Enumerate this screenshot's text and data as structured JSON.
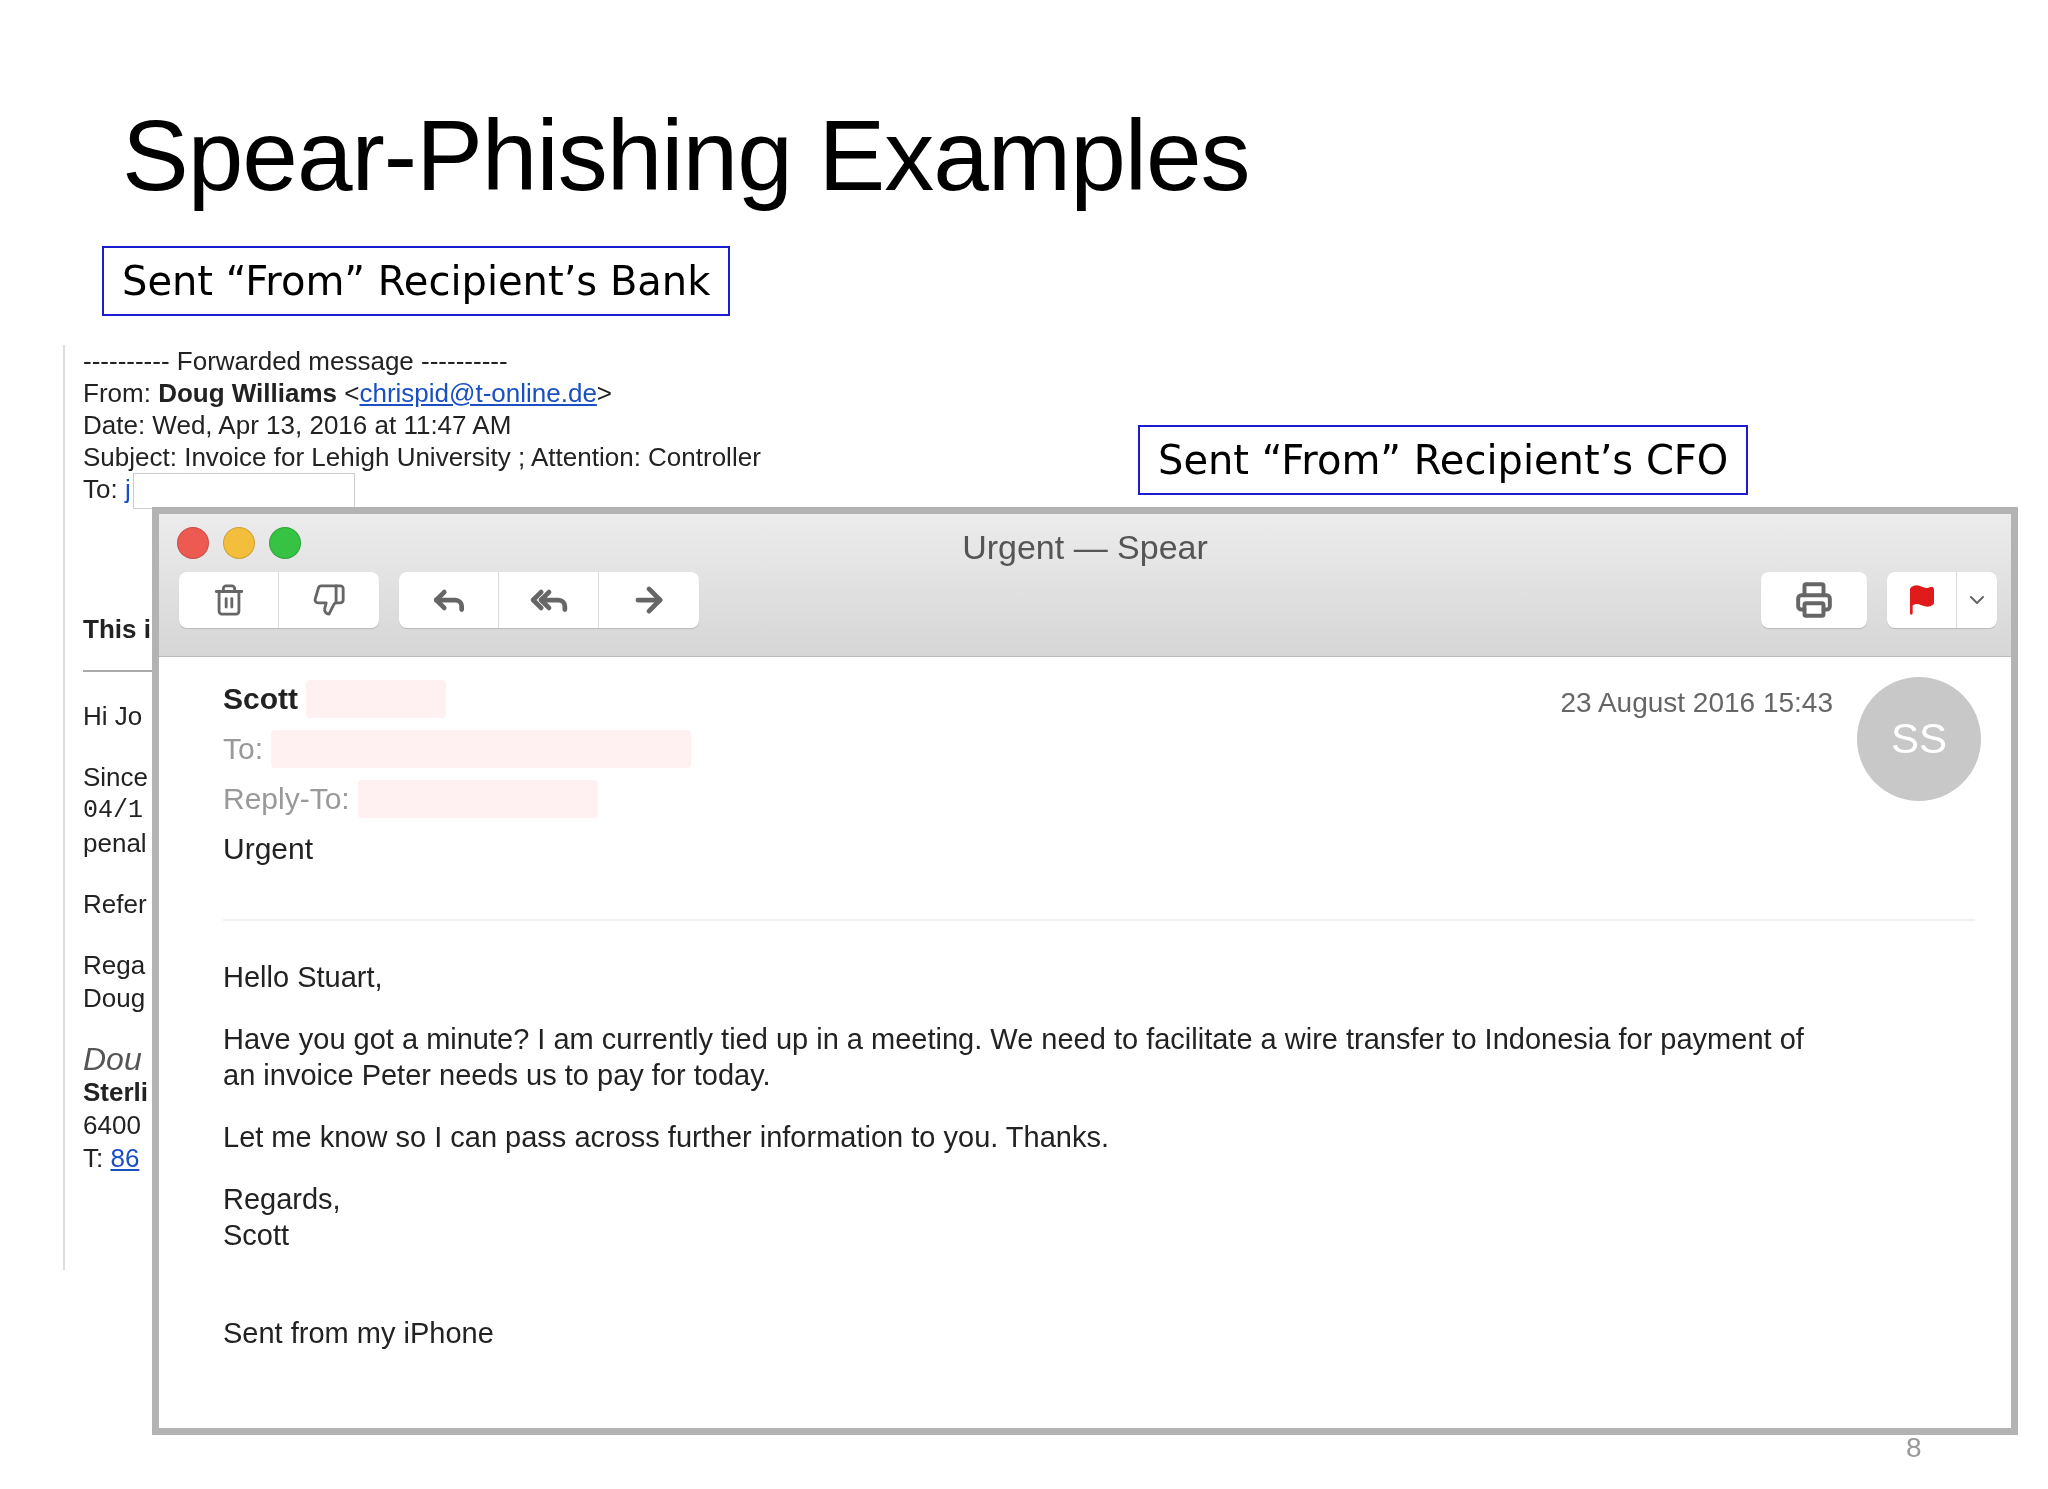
{
  "slide": {
    "title": "Spear-Phishing Examples",
    "page_number": "8"
  },
  "callouts": [
    {
      "text": "Sent “From” Recipient’s Bank"
    },
    {
      "text": "Sent “From” Recipient’s CFO"
    }
  ],
  "back_email": {
    "banner": "---------- Forwarded message ----------",
    "from": {
      "label": "From:",
      "name": "Doug Williams",
      "open": "<",
      "address": "chrispid@t-online.de",
      "close": ">"
    },
    "date": "Date: Wed, Apr 13, 2016 at 11:47 AM",
    "subject": "Subject: Invoice for Lehigh University ; Attention: Controller",
    "to": {
      "label": "To:",
      "link": "j"
    },
    "blocks": [
      {
        "lines": [
          {
            "text": "This i",
            "kind": "bold"
          }
        ],
        "rule": true
      },
      {
        "lines": [
          {
            "text": "Hi Jo",
            "kind": "plain"
          }
        ],
        "rule": false
      },
      {
        "lines": [
          {
            "text": "Since",
            "kind": "plain"
          },
          {
            "text": "04/1",
            "kind": "mono"
          },
          {
            "text": "penal",
            "kind": "plain"
          }
        ],
        "rule": false
      },
      {
        "lines": [
          {
            "text": "Refer",
            "kind": "plain"
          }
        ],
        "rule": false
      },
      {
        "lines": [
          {
            "text": "Rega",
            "kind": "plain"
          },
          {
            "text": "Doug",
            "kind": "plain"
          }
        ],
        "rule": false
      },
      {
        "lines": [
          {
            "text": "Dou",
            "kind": "italic"
          },
          {
            "text": "Sterli",
            "kind": "bold"
          },
          {
            "text": "6400",
            "kind": "plain"
          },
          {
            "text": "T:",
            "kind": "phone",
            "link": "86"
          }
        ],
        "rule": false
      }
    ]
  },
  "mail_window": {
    "title": "Urgent — Spear",
    "message": {
      "sender": "Scott",
      "date": "23 August 2016 15:43",
      "avatar": "SS",
      "to_label": "To:",
      "reply_to_label": "Reply-To:",
      "subject": "Urgent",
      "paragraphs": [
        "Hello Stuart,",
        "Have you got a minute? I am currently tied up in a meeting. We need to facilitate a wire transfer to Indonesia for payment of an invoice Peter needs us to pay for today.",
        "Let me know so I can pass across further information to you. Thanks.",
        "Regards,\nScott",
        "Sent from my iPhone"
      ]
    }
  }
}
